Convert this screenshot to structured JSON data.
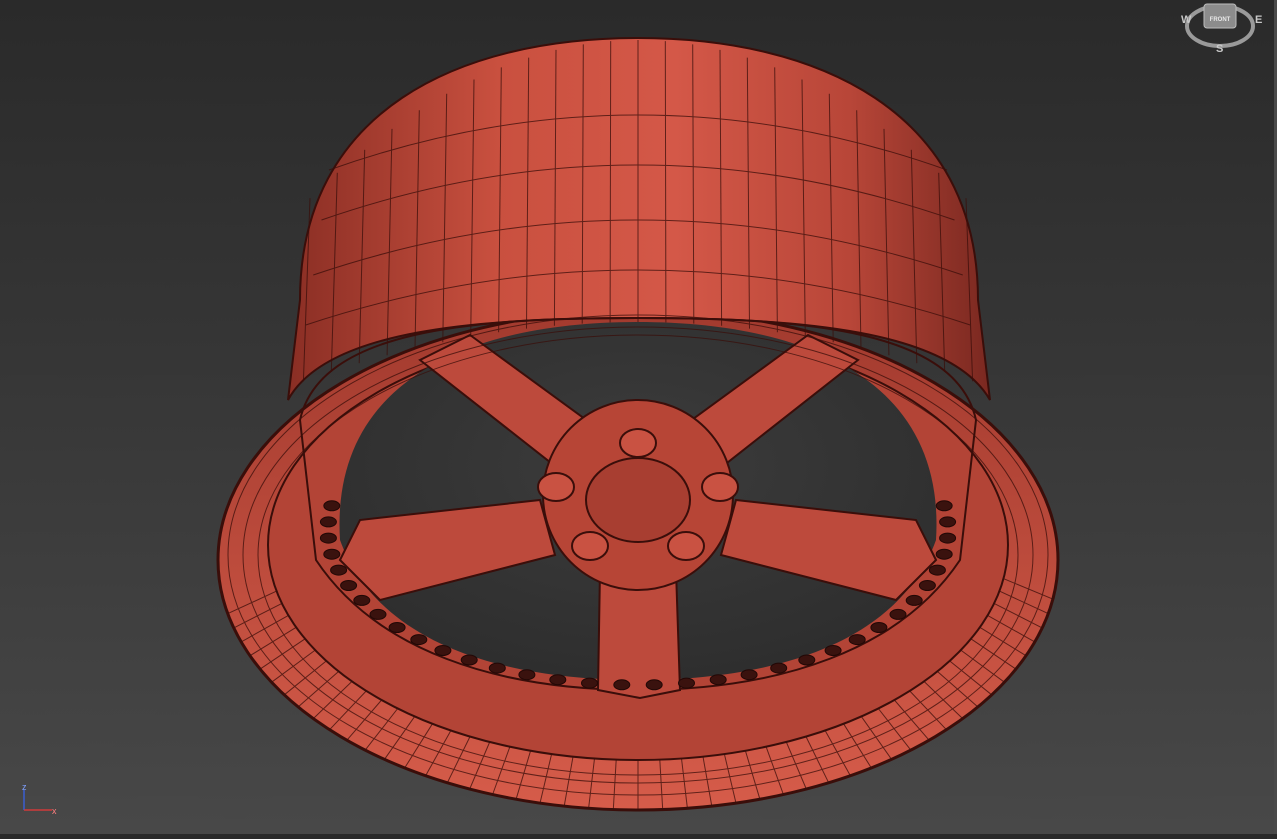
{
  "viewcube": {
    "face_label": "FRONT",
    "compass": {
      "west": "W",
      "east": "E",
      "south": "S"
    }
  },
  "axis_tripod": {
    "z_label": "z",
    "x_label": "x"
  },
  "colors": {
    "background_top": "#2a2a2a",
    "background_bottom": "#484848",
    "model_fill": "#c0473a",
    "wireframe": "#3a0e0a"
  },
  "model": {
    "description_icon": "wheel-rim-wireframe",
    "spoke_count": 5,
    "lug_count": 5
  }
}
